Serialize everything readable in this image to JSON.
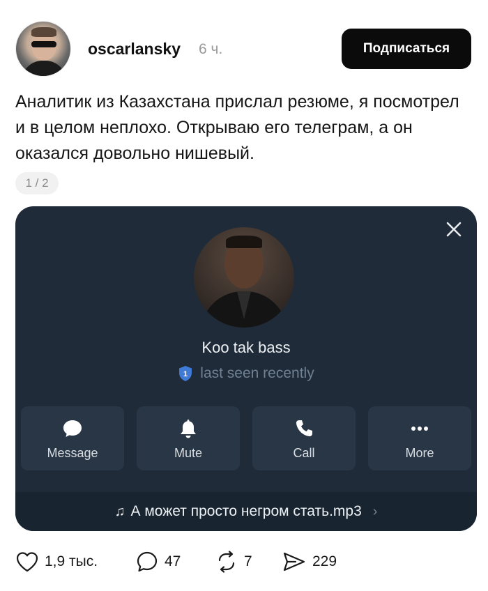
{
  "post": {
    "username": "oscarlansky",
    "time": "6 ч.",
    "subscribe_label": "Подписаться",
    "text": "Аналитик из Казахстана прислал резюме, я посмотрел и в целом неплохо. Открываю его телеграм, а он оказался довольно нишевый.",
    "pager": "1 / 2"
  },
  "telegram_card": {
    "contact_name": "Koo tak bass",
    "status_badge": "1",
    "status": "last seen recently",
    "actions": [
      {
        "label": "Message",
        "icon": "message-icon"
      },
      {
        "label": "Mute",
        "icon": "bell-icon"
      },
      {
        "label": "Call",
        "icon": "phone-icon"
      },
      {
        "label": "More",
        "icon": "more-icon"
      }
    ],
    "music": "А может просто негром стать.mp3"
  },
  "footer": {
    "likes": "1,9 тыс.",
    "comments": "47",
    "reposts": "7",
    "shares": "229"
  },
  "colors": {
    "card_bg": "#1f2b38",
    "action_bg": "#283646",
    "accent_blue": "#3f7ad6",
    "button_black": "#0b0b0b"
  }
}
